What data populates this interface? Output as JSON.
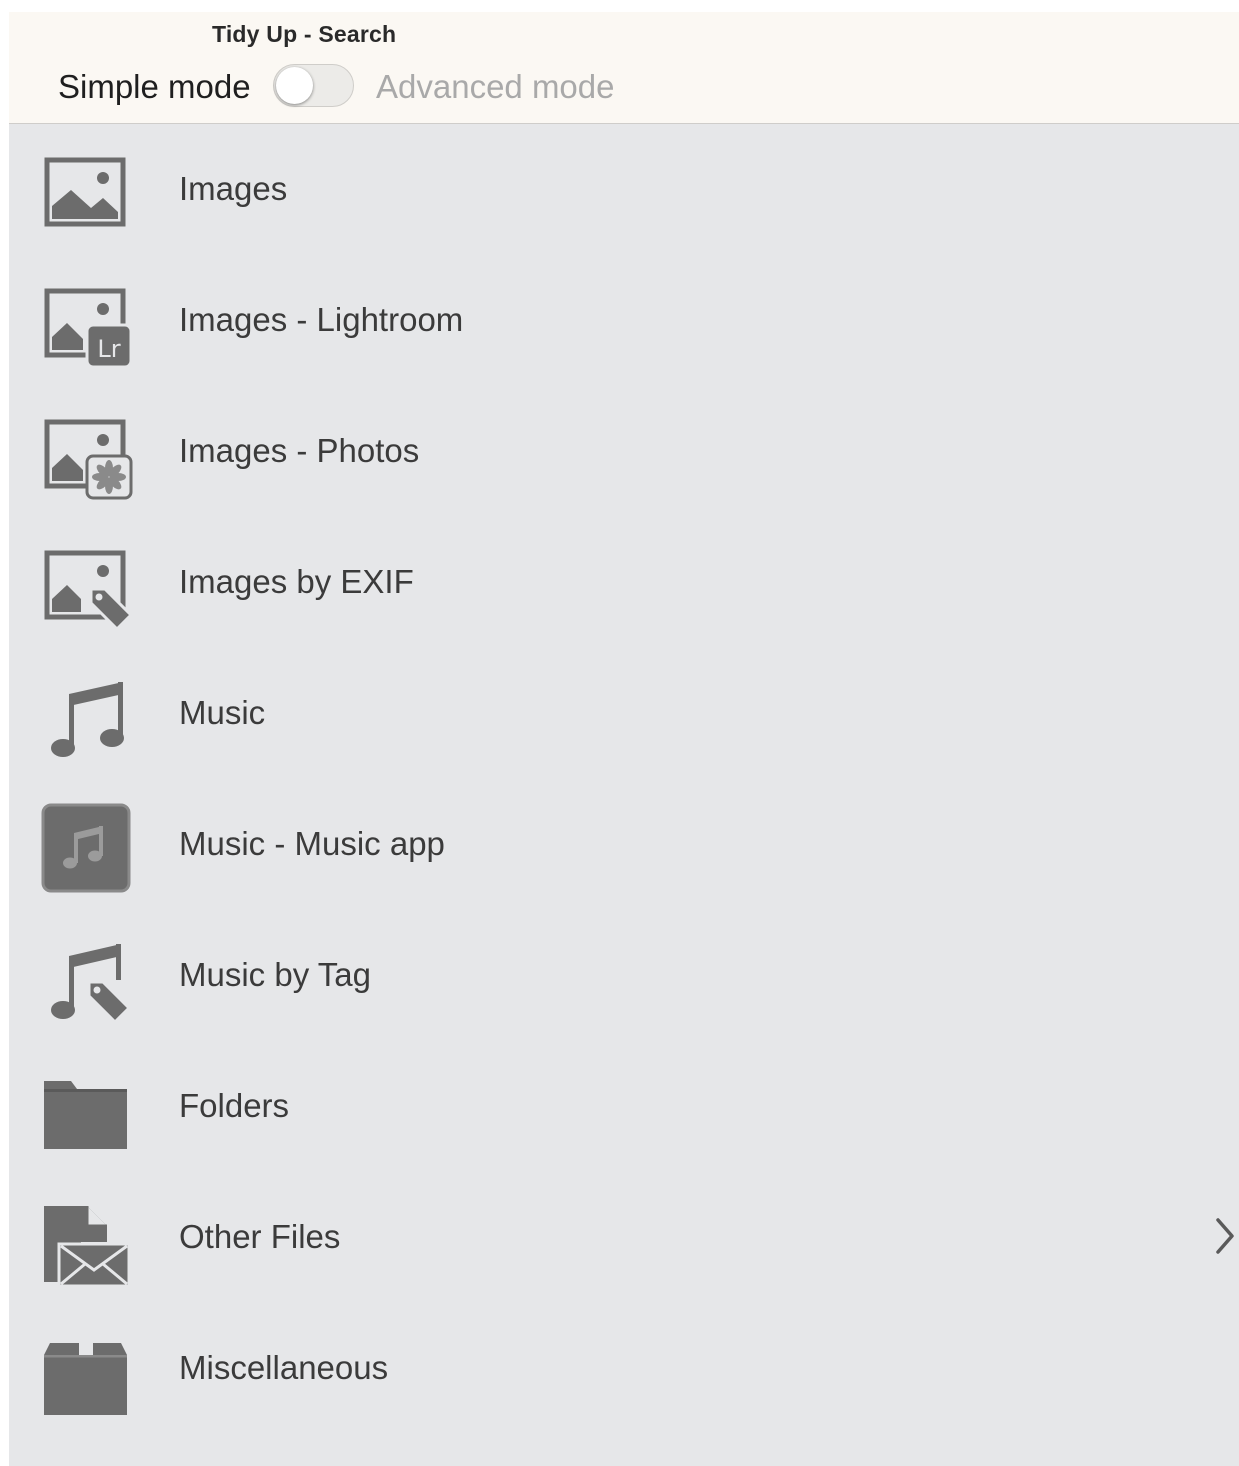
{
  "window": {
    "title": "Tidy Up - Search"
  },
  "mode": {
    "simple_label": "Simple mode",
    "advanced_label": "Advanced mode",
    "advanced_enabled": false
  },
  "categories": [
    {
      "label": "Images",
      "icon": "image-icon"
    },
    {
      "label": "Images - Lightroom",
      "icon": "image-lightroom-icon"
    },
    {
      "label": "Images - Photos",
      "icon": "image-photos-icon"
    },
    {
      "label": "Images by EXIF",
      "icon": "image-tag-icon"
    },
    {
      "label": "Music",
      "icon": "music-note-icon"
    },
    {
      "label": "Music - Music app",
      "icon": "music-app-icon"
    },
    {
      "label": "Music by Tag",
      "icon": "music-tag-icon"
    },
    {
      "label": "Folders",
      "icon": "folder-icon"
    },
    {
      "label": "Other Files",
      "icon": "files-icon",
      "has_disclosure": true
    },
    {
      "label": "Miscellaneous",
      "icon": "box-icon"
    }
  ],
  "colors": {
    "icon_gray": "#6c6c6c",
    "background": "#e6e7e9",
    "header_bg": "#fbf8f3"
  }
}
